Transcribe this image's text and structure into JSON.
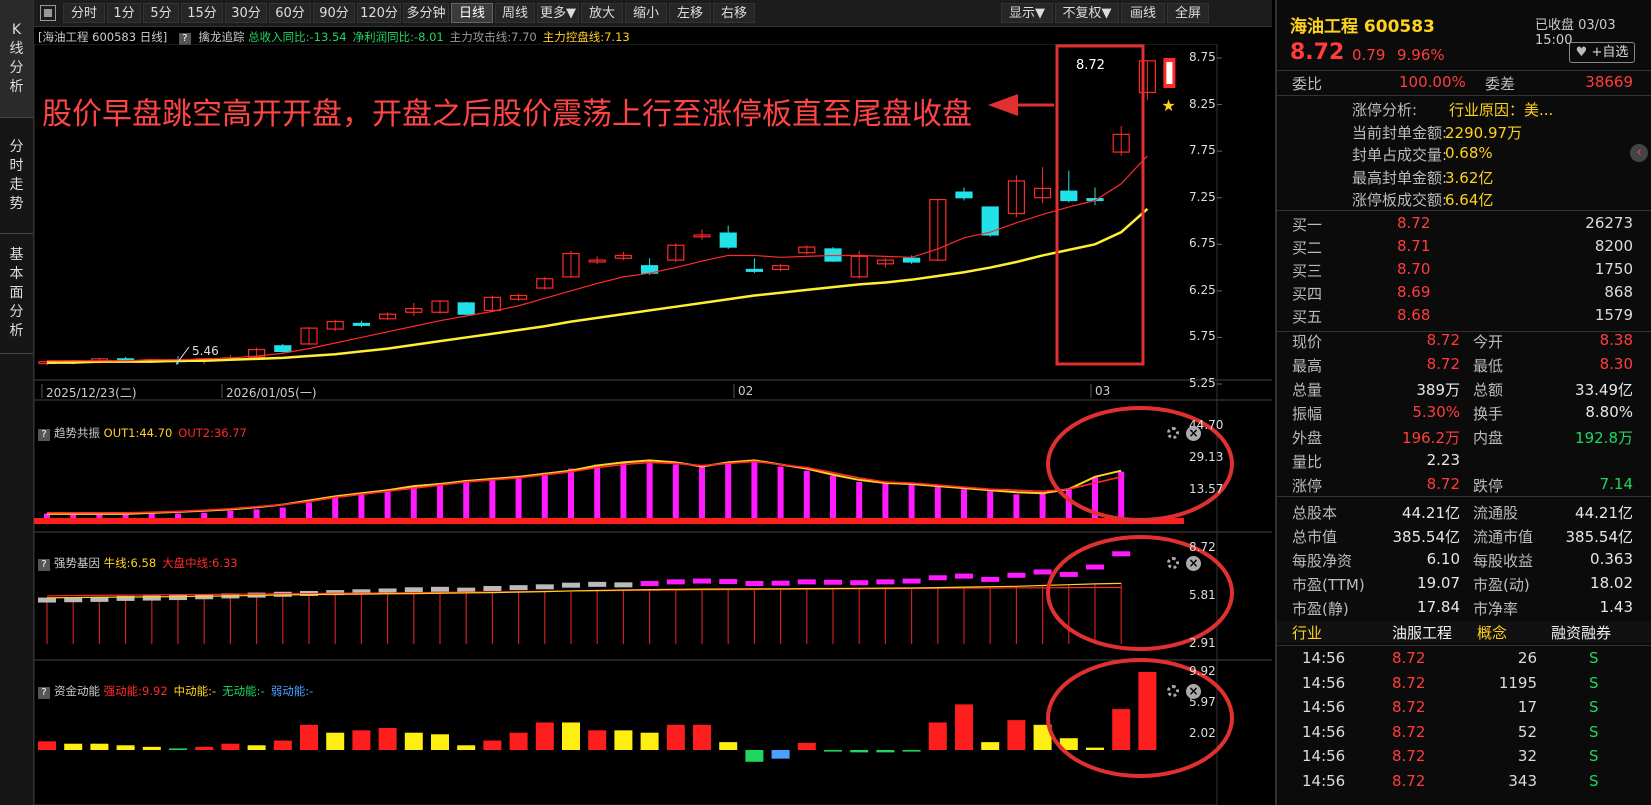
{
  "nav": {
    "tabs": [
      {
        "label": "K线分析",
        "chars": [
          "K",
          "线",
          "分",
          "析"
        ]
      },
      {
        "label": "分时走势",
        "chars": [
          "分",
          "时",
          "走",
          "势"
        ]
      },
      {
        "label": "基本面分析",
        "chars": [
          "基",
          "本",
          "面",
          "分",
          "析"
        ]
      }
    ]
  },
  "toolbar": {
    "buttons": [
      "分时",
      "1分",
      "5分",
      "15分",
      "30分",
      "60分",
      "90分",
      "120分",
      "多分钟",
      "日线",
      "周线",
      "更多▼",
      "放大",
      "缩小",
      "左移",
      "右移"
    ],
    "active": "日线",
    "right_buttons": [
      "显示▼",
      "不复权▼",
      "画线",
      "全屏"
    ]
  },
  "main_chart": {
    "title": "[海油工程 600583 日线]",
    "indicator": "擒龙追踪",
    "info_items": [
      {
        "text": "总收入同比:-13.54",
        "color": "#1ed760"
      },
      {
        "text": "净利润同比:-8.01",
        "color": "#1ed760"
      },
      {
        "text": "主力攻击线:7.70",
        "color": "#999999"
      },
      {
        "text": "主力控盘线:7.13",
        "color": "#ffd21e"
      }
    ],
    "y_axis": [
      "8.75",
      "8.25",
      "7.75",
      "7.25",
      "6.75",
      "6.25",
      "5.75",
      "5.25"
    ],
    "low_label": "5.46",
    "high_label": "8.72",
    "date_labels": [
      "2025/12/23(二)",
      "2026/01/05(一)",
      "02",
      "03"
    ],
    "annotation": "股价早盘跳空高开开盘，开盘之后股价震荡上行至涨停板直至尾盘收盘"
  },
  "chart_data": [
    {
      "type": "candlestick",
      "title": "海油工程 600583 日线",
      "ylim": [
        5.25,
        8.75
      ],
      "candles": [
        [
          5.47,
          5.49,
          5.45,
          5.5
        ],
        [
          5.48,
          5.5,
          5.46,
          5.51
        ],
        [
          5.49,
          5.52,
          5.47,
          5.53
        ],
        [
          5.52,
          5.5,
          5.48,
          5.54
        ],
        [
          5.5,
          5.51,
          5.48,
          5.52
        ],
        [
          5.51,
          5.49,
          5.46,
          5.55
        ],
        [
          5.5,
          5.52,
          5.46,
          5.53
        ],
        [
          5.52,
          5.53,
          5.5,
          5.56
        ],
        [
          5.54,
          5.62,
          5.53,
          5.64
        ],
        [
          5.66,
          5.6,
          5.59,
          5.68
        ],
        [
          5.68,
          5.85,
          5.67,
          5.86
        ],
        [
          5.84,
          5.92,
          5.82,
          5.94
        ],
        [
          5.9,
          5.88,
          5.86,
          5.93
        ],
        [
          5.95,
          6.0,
          5.94,
          6.02
        ],
        [
          6.02,
          6.06,
          5.98,
          6.12
        ],
        [
          6.02,
          6.14,
          6.0,
          6.15
        ],
        [
          6.12,
          6.0,
          5.99,
          6.13
        ],
        [
          6.04,
          6.18,
          6.02,
          6.2
        ],
        [
          6.16,
          6.2,
          6.14,
          6.22
        ],
        [
          6.28,
          6.38,
          6.26,
          6.4
        ],
        [
          6.4,
          6.65,
          6.39,
          6.68
        ],
        [
          6.56,
          6.58,
          6.54,
          6.62
        ],
        [
          6.6,
          6.63,
          6.58,
          6.67
        ],
        [
          6.52,
          6.44,
          6.42,
          6.6
        ],
        [
          6.58,
          6.74,
          6.56,
          6.76
        ],
        [
          6.83,
          6.85,
          6.8,
          6.91
        ],
        [
          6.87,
          6.72,
          6.7,
          6.95
        ],
        [
          6.48,
          6.46,
          6.44,
          6.6
        ],
        [
          6.48,
          6.52,
          6.46,
          6.54
        ],
        [
          6.66,
          6.72,
          6.64,
          6.74
        ],
        [
          6.7,
          6.57,
          6.56,
          6.72
        ],
        [
          6.4,
          6.62,
          6.38,
          6.68
        ],
        [
          6.54,
          6.58,
          6.5,
          6.6
        ],
        [
          6.6,
          6.56,
          6.54,
          6.63
        ],
        [
          6.58,
          7.23,
          6.57,
          7.23
        ],
        [
          7.31,
          7.25,
          7.22,
          7.36
        ],
        [
          7.15,
          6.85,
          6.83,
          7.15
        ],
        [
          7.08,
          7.43,
          7.04,
          7.49
        ],
        [
          7.25,
          7.35,
          7.19,
          7.58
        ],
        [
          7.32,
          7.22,
          7.2,
          7.54
        ],
        [
          7.24,
          7.22,
          7.17,
          7.36
        ],
        [
          7.74,
          7.93,
          7.7,
          8.02
        ],
        [
          8.38,
          8.72,
          8.3,
          8.72
        ]
      ],
      "ma_red": [
        5.5,
        5.5,
        5.5,
        5.5,
        5.51,
        5.51,
        5.52,
        5.53,
        5.55,
        5.58,
        5.63,
        5.69,
        5.75,
        5.81,
        5.87,
        5.93,
        5.98,
        6.03,
        6.09,
        6.17,
        6.25,
        6.33,
        6.4,
        6.44,
        6.5,
        6.57,
        6.63,
        6.63,
        6.61,
        6.62,
        6.63,
        6.63,
        6.62,
        6.61,
        6.7,
        6.82,
        6.88,
        6.98,
        7.07,
        7.15,
        7.22,
        7.4,
        7.7
      ],
      "ma_yellow": [
        5.48,
        5.48,
        5.49,
        5.49,
        5.49,
        5.5,
        5.5,
        5.51,
        5.52,
        5.53,
        5.55,
        5.57,
        5.6,
        5.63,
        5.67,
        5.71,
        5.75,
        5.79,
        5.83,
        5.87,
        5.92,
        5.96,
        6.0,
        6.04,
        6.08,
        6.12,
        6.16,
        6.2,
        6.23,
        6.26,
        6.29,
        6.32,
        6.34,
        6.37,
        6.41,
        6.45,
        6.5,
        6.56,
        6.63,
        6.69,
        6.75,
        6.88,
        7.13
      ]
    },
    {
      "type": "bar",
      "title": "趋势共振",
      "ylim": [
        0,
        44.7
      ],
      "ticks": [
        "44.70",
        "29.13",
        "13.57"
      ],
      "values": [
        2.2,
        2.0,
        2.2,
        1.5,
        2.2,
        2.2,
        2.5,
        3.5,
        4.2,
        5.1,
        7.5,
        10,
        12,
        13.8,
        15.5,
        17,
        18.5,
        19.5,
        20.5,
        22,
        24,
        26,
        27,
        28,
        26,
        25,
        27,
        28,
        25,
        23,
        20.5,
        17.5,
        17.5,
        16.8,
        15.5,
        14,
        13,
        11.5,
        12.5,
        14.5,
        20,
        22.5
      ],
      "series": [
        {
          "name": "OUT1",
          "label": "OUT1:44.70",
          "color": "#ffd21e",
          "line": [
            2,
            2,
            2,
            2,
            2.5,
            3,
            3.5,
            4.2,
            5.2,
            6.5,
            8.5,
            10.5,
            12,
            13.5,
            15.5,
            16.5,
            18,
            19,
            20,
            21.5,
            23,
            25.5,
            27,
            28,
            27,
            25,
            27,
            28,
            26,
            24,
            21,
            18.5,
            17,
            16.5,
            15.5,
            14.5,
            13.5,
            12.5,
            12,
            14,
            20,
            23
          ]
        },
        {
          "name": "OUT2",
          "label": "OUT2:36.77",
          "color": "#ff2a2a",
          "line": [
            2.5,
            2.5,
            2.5,
            2.5,
            2.8,
            3.2,
            3.8,
            4.5,
            5.5,
            6.5,
            8,
            10,
            11.5,
            13,
            14.5,
            16,
            17.5,
            18.5,
            19.5,
            21,
            22.5,
            24.5,
            26,
            27,
            26.5,
            25.5,
            26.5,
            27.5,
            26,
            24.5,
            22,
            19.5,
            17.5,
            17,
            16,
            15,
            14,
            13.5,
            13,
            14,
            17,
            20
          ]
        }
      ]
    },
    {
      "type": "bar",
      "title": "强势基因",
      "ylim": [
        2.91,
        8.72
      ],
      "ticks": [
        "8.72",
        "5.81",
        "2.91"
      ],
      "series": [
        {
          "name": "牛线",
          "label": "牛线:6.58",
          "color": "#ffd21e"
        },
        {
          "name": "大盘中线",
          "label": "大盘中线:6.33",
          "color": "#ff2a2a"
        }
      ],
      "bull_line": [
        5.7,
        5.72,
        5.74,
        5.75,
        5.76,
        5.78,
        5.8,
        5.82,
        5.85,
        5.88,
        5.9,
        5.92,
        5.93,
        5.95,
        5.96,
        5.98,
        6.0,
        6.02,
        6.05,
        6.08,
        6.12,
        6.15,
        6.18,
        6.2,
        6.22,
        6.23,
        6.24,
        6.25,
        6.25,
        6.26,
        6.27,
        6.28,
        6.29,
        6.3,
        6.32,
        6.35,
        6.38,
        6.4,
        6.45,
        6.5,
        6.55,
        6.58
      ],
      "market_line": [
        5.82,
        5.84,
        5.86,
        5.87,
        5.88,
        5.9,
        5.91,
        5.92,
        5.93,
        5.95,
        5.96,
        5.98,
        5.99,
        6.0,
        6.02,
        6.03,
        6.05,
        6.06,
        6.08,
        6.1,
        6.12,
        6.13,
        6.15,
        6.16,
        6.18,
        6.19,
        6.2,
        6.21,
        6.22,
        6.23,
        6.24,
        6.25,
        6.26,
        6.27,
        6.28,
        6.29,
        6.3,
        6.31,
        6.31,
        6.32,
        6.33,
        6.33
      ],
      "blocks": [
        5.6,
        5.62,
        5.64,
        5.7,
        5.72,
        5.75,
        5.8,
        5.85,
        5.9,
        5.95,
        6.0,
        6.05,
        6.1,
        6.15,
        6.22,
        6.25,
        6.2,
        6.3,
        6.35,
        6.4,
        6.5,
        6.55,
        6.52,
        6.6,
        6.7,
        6.75,
        6.72,
        6.6,
        6.62,
        6.7,
        6.68,
        6.65,
        6.7,
        6.75,
        6.95,
        7.05,
        6.85,
        7.1,
        7.3,
        7.15,
        7.6,
        8.4
      ],
      "block_colors": [
        "w",
        "w",
        "w",
        "w",
        "w",
        "w",
        "w",
        "w",
        "w",
        "w",
        "w",
        "w",
        "w",
        "w",
        "w",
        "w",
        "w",
        "w",
        "w",
        "w",
        "w",
        "w",
        "w",
        "m",
        "m",
        "m",
        "m",
        "m",
        "m",
        "m",
        "m",
        "m",
        "m",
        "m",
        "m",
        "m",
        "m",
        "m",
        "m",
        "m",
        "m",
        "m"
      ]
    },
    {
      "type": "bar",
      "title": "资金动能",
      "ylim": [
        0,
        9.92
      ],
      "ticks": [
        "9.92",
        "5.97",
        "2.02"
      ],
      "series": [
        {
          "name": "强动能",
          "label": "强动能:9.92",
          "color": "#ff2a2a"
        },
        {
          "name": "中动能",
          "label": "中动能:-",
          "color": "#ffd21e"
        },
        {
          "name": "无动能",
          "label": "无动能:-",
          "color": "#1ed760"
        },
        {
          "name": "弱动能",
          "label": "弱动能:-",
          "color": "#4a9fff"
        }
      ],
      "values": [
        1.1,
        0.8,
        0.8,
        0.6,
        0.4,
        0.2,
        0.4,
        0.8,
        0.6,
        1.2,
        3.2,
        2.2,
        2.5,
        2.8,
        2.2,
        2.0,
        0.6,
        1.2,
        2.2,
        3.5,
        3.5,
        2.5,
        2.5,
        2.2,
        3.2,
        3.2,
        1.0,
        -1.5,
        -1.1,
        0.9,
        -0.2,
        -0.3,
        -0.3,
        -0.2,
        3.5,
        5.8,
        1.0,
        3.8,
        3.2,
        1.5,
        0.3,
        5.2,
        9.92
      ],
      "value_colors": [
        "r",
        "y",
        "y",
        "y",
        "y",
        "g",
        "r",
        "r",
        "y",
        "r",
        "r",
        "y",
        "r",
        "r",
        "y",
        "y",
        "y",
        "r",
        "r",
        "r",
        "y",
        "r",
        "y",
        "y",
        "r",
        "r",
        "y",
        "g",
        "b",
        "r",
        "g",
        "g",
        "g",
        "g",
        "r",
        "r",
        "y",
        "r",
        "y",
        "y",
        "y",
        "r",
        "r"
      ]
    }
  ],
  "panel2": {
    "name": "趋势共振",
    "items": [
      {
        "text": "OUT1:44.70",
        "color": "#ffd21e"
      },
      {
        "text": "OUT2:36.77",
        "color": "#ff2a2a"
      }
    ]
  },
  "panel3": {
    "name": "强势基因",
    "items": [
      {
        "text": "牛线:6.58",
        "color": "#ffd21e"
      },
      {
        "text": "大盘中线:6.33",
        "color": "#ff2a2a"
      }
    ]
  },
  "panel4": {
    "name": "资金动能",
    "items": [
      {
        "text": "强动能:9.92",
        "color": "#ff2a2a"
      },
      {
        "text": "中动能:-",
        "color": "#ffd21e"
      },
      {
        "text": "无动能:-",
        "color": "#1ed760"
      },
      {
        "text": "弱动能:-",
        "color": "#4a9fff"
      }
    ]
  },
  "quote": {
    "name_code": "海油工程 600583",
    "status": "已收盘 03/03 15:00",
    "price": "8.72",
    "change": "0.79",
    "change_pct": "9.96%",
    "watch_button": "+自选",
    "weibi_label": "委比",
    "weibi": "100.00%",
    "weicha_label": "委差",
    "weicha": "38669",
    "limit_info": [
      {
        "label": "涨停分析:",
        "value": "行业原因：美..."
      },
      {
        "label": "当前封单金额:",
        "value": "2290.97万"
      },
      {
        "label": "封单占成交量:",
        "value": "0.68%"
      },
      {
        "label": "最高封单金额:",
        "value": "3.62亿"
      },
      {
        "label": "涨停板成交额:",
        "value": "6.64亿"
      }
    ],
    "bids": [
      {
        "label": "买一",
        "price": "8.72",
        "vol": "26273"
      },
      {
        "label": "买二",
        "price": "8.71",
        "vol": "8200"
      },
      {
        "label": "买三",
        "price": "8.70",
        "vol": "1750"
      },
      {
        "label": "买四",
        "price": "8.69",
        "vol": "868"
      },
      {
        "label": "买五",
        "price": "8.68",
        "vol": "1579"
      }
    ],
    "stats": [
      [
        {
          "l": "现价",
          "v": "8.72",
          "c": "red"
        },
        {
          "l": "今开",
          "v": "8.38",
          "c": "red"
        }
      ],
      [
        {
          "l": "最高",
          "v": "8.72",
          "c": "red"
        },
        {
          "l": "最低",
          "v": "8.30",
          "c": "red"
        }
      ],
      [
        {
          "l": "总量",
          "v": "389万",
          "c": "gray"
        },
        {
          "l": "总额",
          "v": "33.49亿",
          "c": "gray"
        }
      ],
      [
        {
          "l": "振幅",
          "v": "5.30%",
          "c": "red"
        },
        {
          "l": "换手",
          "v": "8.80%",
          "c": "gray"
        }
      ],
      [
        {
          "l": "外盘",
          "v": "196.2万",
          "c": "red"
        },
        {
          "l": "内盘",
          "v": "192.8万",
          "c": "green"
        }
      ],
      [
        {
          "l": "量比",
          "v": "2.23",
          "c": "gray"
        },
        {
          "l": "",
          "v": "",
          "c": "gray"
        }
      ],
      [
        {
          "l": "涨停",
          "v": "8.72",
          "c": "red"
        },
        {
          "l": "跌停",
          "v": "7.14",
          "c": "green"
        }
      ],
      [
        {
          "l": "总股本",
          "v": "44.21亿",
          "c": "gray"
        },
        {
          "l": "流通股",
          "v": "44.21亿",
          "c": "gray"
        }
      ],
      [
        {
          "l": "总市值",
          "v": "385.54亿",
          "c": "gray"
        },
        {
          "l": "流通市值",
          "v": "385.54亿",
          "c": "gray"
        }
      ],
      [
        {
          "l": "每股净资",
          "v": "6.10",
          "c": "gray"
        },
        {
          "l": "每股收益",
          "v": "0.363",
          "c": "gray"
        }
      ],
      [
        {
          "l": "市盈(TTM)",
          "v": "19.07",
          "c": "gray"
        },
        {
          "l": "市盈(动)",
          "v": "18.02",
          "c": "gray"
        }
      ],
      [
        {
          "l": "市盈(静)",
          "v": "17.84",
          "c": "gray"
        },
        {
          "l": "市净率",
          "v": "1.43",
          "c": "gray"
        }
      ]
    ],
    "industry_label": "行业",
    "industry": "油服工程",
    "concept_label": "概念",
    "margin_label": "融资融券",
    "trades": [
      {
        "time": "14:56",
        "price": "8.72",
        "vol": "26",
        "side": "S"
      },
      {
        "time": "14:56",
        "price": "8.72",
        "vol": "1195",
        "side": "S"
      },
      {
        "time": "14:56",
        "price": "8.72",
        "vol": "17",
        "side": "S"
      },
      {
        "time": "14:56",
        "price": "8.72",
        "vol": "52",
        "side": "S"
      },
      {
        "time": "14:56",
        "price": "8.72",
        "vol": "32",
        "side": "S"
      },
      {
        "time": "14:56",
        "price": "8.72",
        "vol": "343",
        "side": "S"
      }
    ]
  },
  "colors": {
    "up": "#ff2a2a",
    "down": "#21e2e8",
    "ma_red": "#ff2a2a",
    "ma_yellow": "#ffee33",
    "magenta": "#ff1aff",
    "annot": "#e03030"
  }
}
